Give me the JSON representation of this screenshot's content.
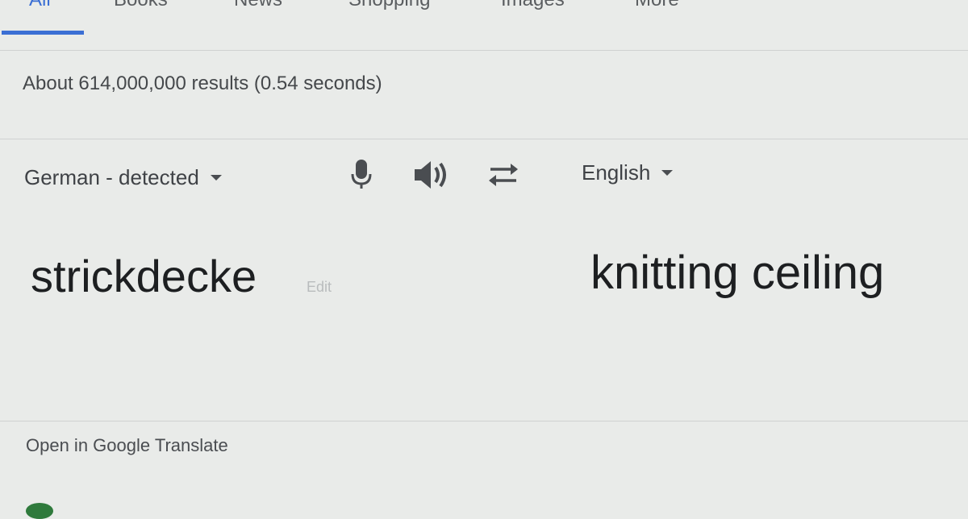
{
  "tabs": [
    {
      "label": "All",
      "active": true
    },
    {
      "label": "Books",
      "active": false
    },
    {
      "label": "News",
      "active": false
    },
    {
      "label": "Shopping",
      "active": false
    },
    {
      "label": "Images",
      "active": false
    },
    {
      "label": "More",
      "active": false
    }
  ],
  "results_stats": "About 614,000,000 results (0.54 seconds)",
  "translator": {
    "source_language": "German - detected",
    "target_language": "English",
    "source_text": "strickdecke",
    "edit_label": "Edit",
    "translated_text": "knitting ceiling",
    "icons": [
      "microphone-icon",
      "speaker-icon",
      "swap-icon",
      "caret-down-icon"
    ]
  },
  "footer_link": "Open in Google Translate",
  "colors": {
    "accent": "#3b6fd4",
    "background": "#e9ebe9"
  }
}
